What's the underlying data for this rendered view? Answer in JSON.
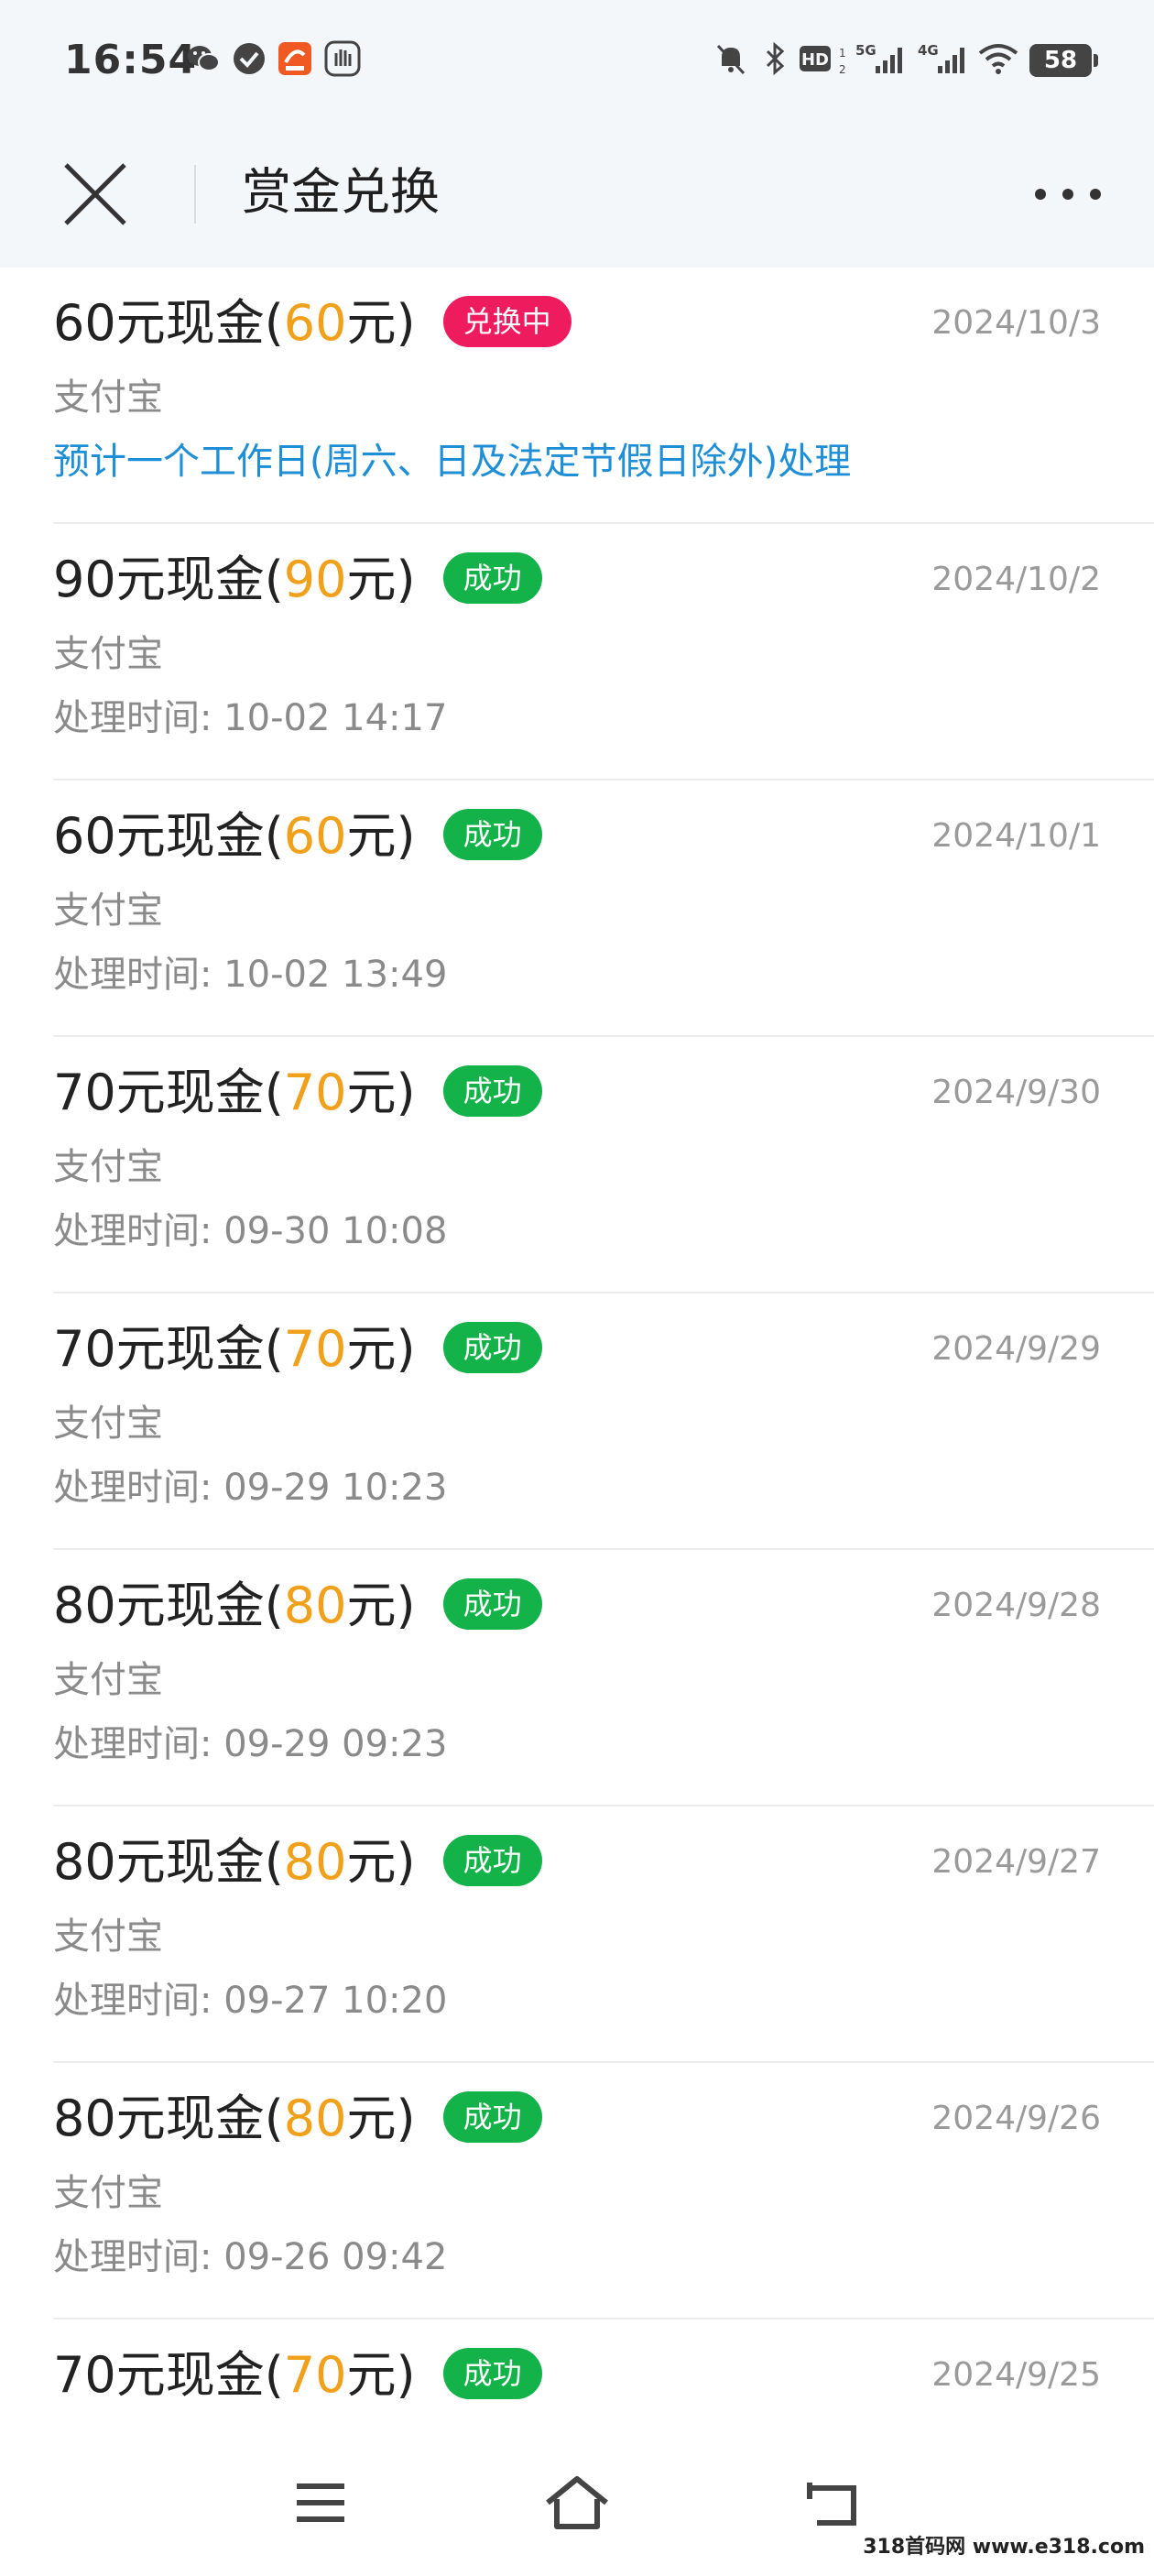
{
  "status_bar": {
    "time": "16:54",
    "battery": "58",
    "icons": [
      "wechat-icon",
      "check-circle-icon",
      "app-notification-icon",
      "hand-icon",
      "mute-bell-icon",
      "bluetooth-icon",
      "hd-icon",
      "signal-5g-icon",
      "signal-4g-icon",
      "wifi-icon",
      "battery-icon"
    ]
  },
  "header": {
    "title": "赏金兑换",
    "close_icon": "close-icon",
    "more_icon": "more-icon"
  },
  "colors": {
    "amount": "#f0a01a",
    "success_badge": "#14b34a",
    "pending_badge": "#ee1b5e",
    "note": "#1e8fd6",
    "header_bg": "#f4f7fa"
  },
  "items": [
    {
      "prefix": "60元现金(",
      "amount": "60",
      "suffix": "元)",
      "badge": "兑换中",
      "status": "pending",
      "date": "2024/10/3",
      "method": "支付宝",
      "note": "预计一个工作日(周六、日及法定节假日除外)处理"
    },
    {
      "prefix": "90元现金(",
      "amount": "90",
      "suffix": "元)",
      "badge": "成功",
      "status": "success",
      "date": "2024/10/2",
      "method": "支付宝",
      "time": "处理时间: 10-02 14:17"
    },
    {
      "prefix": "60元现金(",
      "amount": "60",
      "suffix": "元)",
      "badge": "成功",
      "status": "success",
      "date": "2024/10/1",
      "method": "支付宝",
      "time": "处理时间: 10-02 13:49"
    },
    {
      "prefix": "70元现金(",
      "amount": "70",
      "suffix": "元)",
      "badge": "成功",
      "status": "success",
      "date": "2024/9/30",
      "method": "支付宝",
      "time": "处理时间: 09-30 10:08"
    },
    {
      "prefix": "70元现金(",
      "amount": "70",
      "suffix": "元)",
      "badge": "成功",
      "status": "success",
      "date": "2024/9/29",
      "method": "支付宝",
      "time": "处理时间: 09-29 10:23"
    },
    {
      "prefix": "80元现金(",
      "amount": "80",
      "suffix": "元)",
      "badge": "成功",
      "status": "success",
      "date": "2024/9/28",
      "method": "支付宝",
      "time": "处理时间: 09-29 09:23"
    },
    {
      "prefix": "80元现金(",
      "amount": "80",
      "suffix": "元)",
      "badge": "成功",
      "status": "success",
      "date": "2024/9/27",
      "method": "支付宝",
      "time": "处理时间: 09-27 10:20"
    },
    {
      "prefix": "80元现金(",
      "amount": "80",
      "suffix": "元)",
      "badge": "成功",
      "status": "success",
      "date": "2024/9/26",
      "method": "支付宝",
      "time": "处理时间: 09-26 09:42"
    },
    {
      "prefix": "70元现金(",
      "amount": "70",
      "suffix": "元)",
      "badge": "成功",
      "status": "success",
      "date": "2024/9/25"
    }
  ],
  "bottom_nav": {
    "icons": [
      "menu-icon",
      "home-icon",
      "back-icon"
    ]
  },
  "watermark": "318首码网 www.e318.com"
}
